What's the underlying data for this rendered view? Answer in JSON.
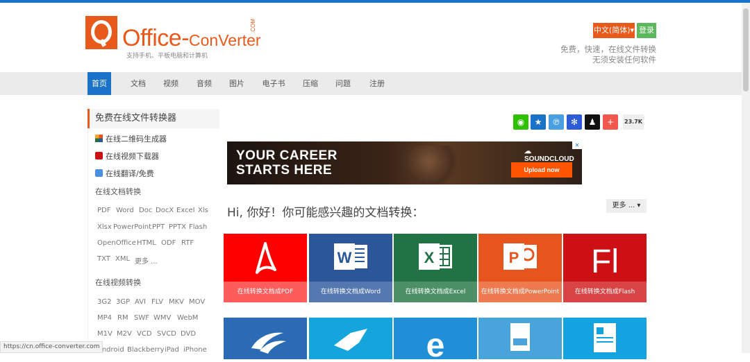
{
  "header": {
    "logo_office": "Office",
    "logo_dash": "-",
    "logo_conv": "ConVerter",
    "logo_com": ".COM",
    "tagline": "支持手机、平板电脑和计算机",
    "lang_label": "中文(简体)▾",
    "login_label": "登录",
    "slogan_line1": "免费，快速，在线文件转换",
    "slogan_line2": "无须安装任何软件"
  },
  "nav": {
    "items": [
      {
        "label": "首页"
      },
      {
        "label": "文档"
      },
      {
        "label": "视频"
      },
      {
        "label": "音频"
      },
      {
        "label": "图片"
      },
      {
        "label": "电子书"
      },
      {
        "label": "压缩"
      },
      {
        "label": "问题"
      },
      {
        "label": "注册"
      }
    ]
  },
  "sidebar": {
    "title": "免费在线文件转换器",
    "links": [
      {
        "label": "在线二维码生成器",
        "icon": "qrcode-icon"
      },
      {
        "label": "在线视频下载器",
        "icon": "youtube-icon"
      },
      {
        "label": "在线翻译/免费",
        "icon": "translate-icon"
      }
    ],
    "doc_heading": "在线文档转换",
    "doc_formats": [
      "PDF",
      "Word",
      "Doc",
      "DocX",
      "Excel",
      "Xls",
      "Xlsx",
      "PowerPoint",
      "PPT",
      "PPTX",
      "Flash",
      "OpenOffice",
      "HTML",
      "ODF",
      "RTF",
      "TXT",
      "XML",
      "更多 ..."
    ],
    "video_heading": "在线视频转换",
    "video_formats": [
      "3G2",
      "3GP",
      "AVI",
      "FLV",
      "MKV",
      "MOV",
      "MP4",
      "RM",
      "SWF",
      "WMV",
      "WebM",
      "M1V",
      "M2V",
      "VCD",
      "SVCD",
      "DVD",
      "Android",
      "Blackberry",
      "iPad",
      "iPhone"
    ]
  },
  "share": {
    "count": "23.7K"
  },
  "ad": {
    "line1": "YOUR CAREER",
    "line2": "STARTS HERE",
    "brand": "SOUNDCLOUD",
    "cta": "Upload now",
    "close": "✕"
  },
  "main": {
    "greeting": "Hi, 你好！你可能感兴趣的文档转换：",
    "more_label": "更多 ... ▾",
    "tiles": [
      {
        "label": "在线转换文档成PDF",
        "color": "#ff0000",
        "bottom": "#ff5c5c"
      },
      {
        "label": "在线转换文档成Word",
        "color": "#2b579a",
        "bottom": "#5578b0"
      },
      {
        "label": "在线转换文档成Excel",
        "color": "#217346",
        "bottom": "#4d9068"
      },
      {
        "label": "在线转换文档成PowerPoint",
        "color": "#e8541e",
        "bottom": "#ee7a50"
      },
      {
        "label": "在线转换文档成Flash",
        "color": "#cc1014",
        "bottom": "#d94447"
      }
    ]
  },
  "status_bar": "https://cn.office-converter.com"
}
